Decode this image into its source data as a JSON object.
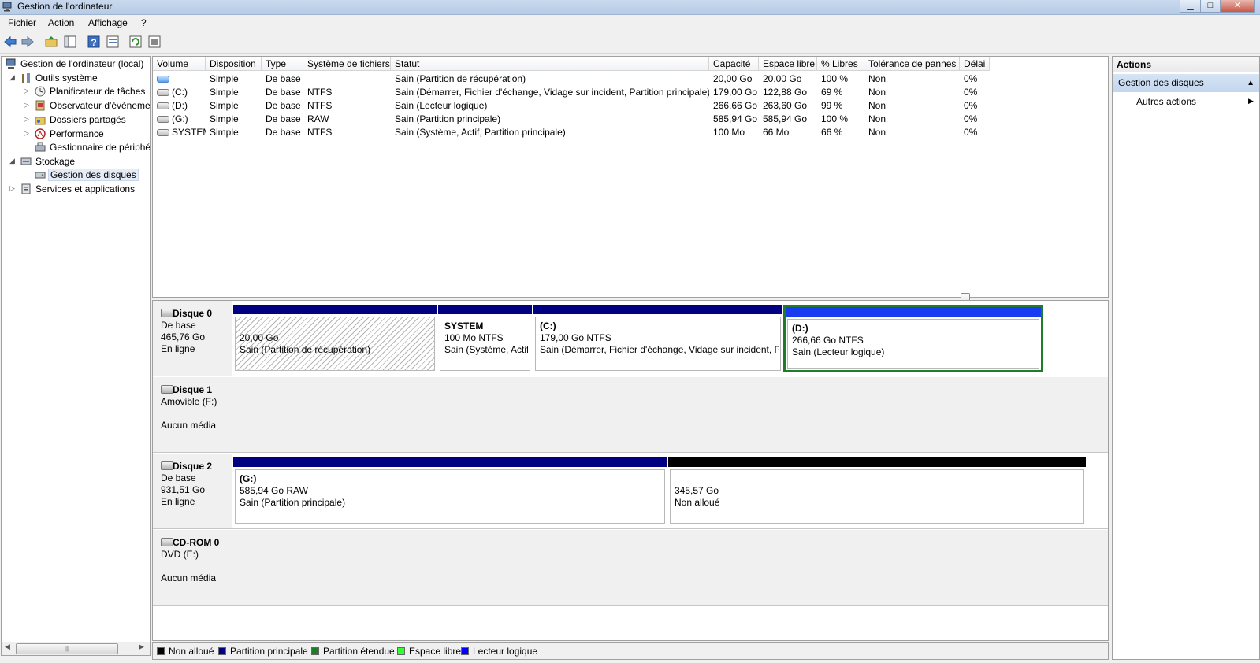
{
  "window": {
    "title": "Gestion de l'ordinateur",
    "minimize": "▁",
    "maximize": "□",
    "close": "✕"
  },
  "menu": [
    "Fichier",
    "Action",
    "Affichage",
    "?"
  ],
  "toolbar": {
    "icons": [
      "back-icon",
      "forward-icon",
      "up-folder-icon",
      "show-hide-tree-icon",
      "help-icon",
      "properties-icon",
      "refresh-icon",
      "export-icon"
    ]
  },
  "tree": {
    "root": "Gestion de l'ordinateur (local)",
    "items": [
      "Outils système",
      "Planificateur de tâches",
      "Observateur d'événeme",
      "Dossiers partagés",
      "Performance",
      "Gestionnaire de périphé",
      "Stockage",
      "Gestion des disques",
      "Services et applications"
    ],
    "scroll_mark": "|||"
  },
  "volume_table": {
    "columns": [
      "Volume",
      "Disposition",
      "Type",
      "Système de fichiers",
      "Statut",
      "Capacité",
      "Espace libre",
      "% Libres",
      "Tolérance de pannes",
      "Délai"
    ],
    "rows": [
      [
        "",
        "Simple",
        "De base",
        "",
        "Sain (Partition de récupération)",
        "20,00 Go",
        "20,00 Go",
        "100 %",
        "Non",
        "0%"
      ],
      [
        "(C:)",
        "Simple",
        "De base",
        "NTFS",
        "Sain (Démarrer, Fichier d'échange, Vidage sur incident, Partition principale)",
        "179,00 Go",
        "122,88 Go",
        "69 %",
        "Non",
        "0%"
      ],
      [
        "(D:)",
        "Simple",
        "De base",
        "NTFS",
        "Sain (Lecteur logique)",
        "266,66 Go",
        "263,60 Go",
        "99 %",
        "Non",
        "0%"
      ],
      [
        "(G:)",
        "Simple",
        "De base",
        "RAW",
        "Sain (Partition principale)",
        "585,94 Go",
        "585,94 Go",
        "100 %",
        "Non",
        "0%"
      ],
      [
        "SYSTEM",
        "Simple",
        "De base",
        "NTFS",
        "Sain (Système, Actif, Partition principale)",
        "100 Mo",
        "66 Mo",
        "66 %",
        "Non",
        "0%"
      ]
    ]
  },
  "disks": [
    {
      "name": "Disque 0",
      "line1": "De base",
      "line2": "465,76 Go",
      "line3": "En ligne",
      "partitions": [
        {
          "title": "",
          "size": "20,00 Go",
          "status": "Sain (Partition de récupération)"
        },
        {
          "title": "SYSTEM",
          "size": "100 Mo NTFS",
          "status": "Sain (Système, Actif,"
        },
        {
          "title": "(C:)",
          "size": "179,00 Go NTFS",
          "status": "Sain (Démarrer, Fichier d'échange, Vidage sur incident, Par"
        },
        {
          "title": "(D:)",
          "size": "266,66 Go NTFS",
          "status": "Sain (Lecteur logique)"
        }
      ]
    },
    {
      "name": "Disque 1",
      "line1": "Amovible (F:)",
      "line2": "",
      "line3": "Aucun média",
      "partitions": []
    },
    {
      "name": "Disque 2",
      "line1": "De base",
      "line2": "931,51 Go",
      "line3": "En ligne",
      "partitions": [
        {
          "title": "(G:)",
          "size": "585,94 Go RAW",
          "status": "Sain (Partition principale)"
        },
        {
          "title": "",
          "size": "345,57 Go",
          "status": "Non alloué"
        }
      ]
    },
    {
      "name": "CD-ROM 0",
      "line1": "DVD (E:)",
      "line2": "",
      "line3": "Aucun média",
      "partitions": []
    }
  ],
  "legend": [
    {
      "label": "Non alloué",
      "color": "#000000"
    },
    {
      "label": "Partition principale",
      "color": "#000080"
    },
    {
      "label": "Partition étendue",
      "color": "#1e7d2a"
    },
    {
      "label": "Espace libre",
      "color": "#33ff33"
    },
    {
      "label": "Lecteur logique",
      "color": "#0000ff"
    }
  ],
  "actions": {
    "header": "Actions",
    "section": "Gestion des disques",
    "more": "Autres actions",
    "collapse_arrow": "▲",
    "more_arrow": "▶"
  },
  "colors": {
    "primary_partition": "#000080",
    "logical_drive": "#1a3cf0",
    "unallocated": "#000000",
    "selection": "#1e7d2a"
  }
}
